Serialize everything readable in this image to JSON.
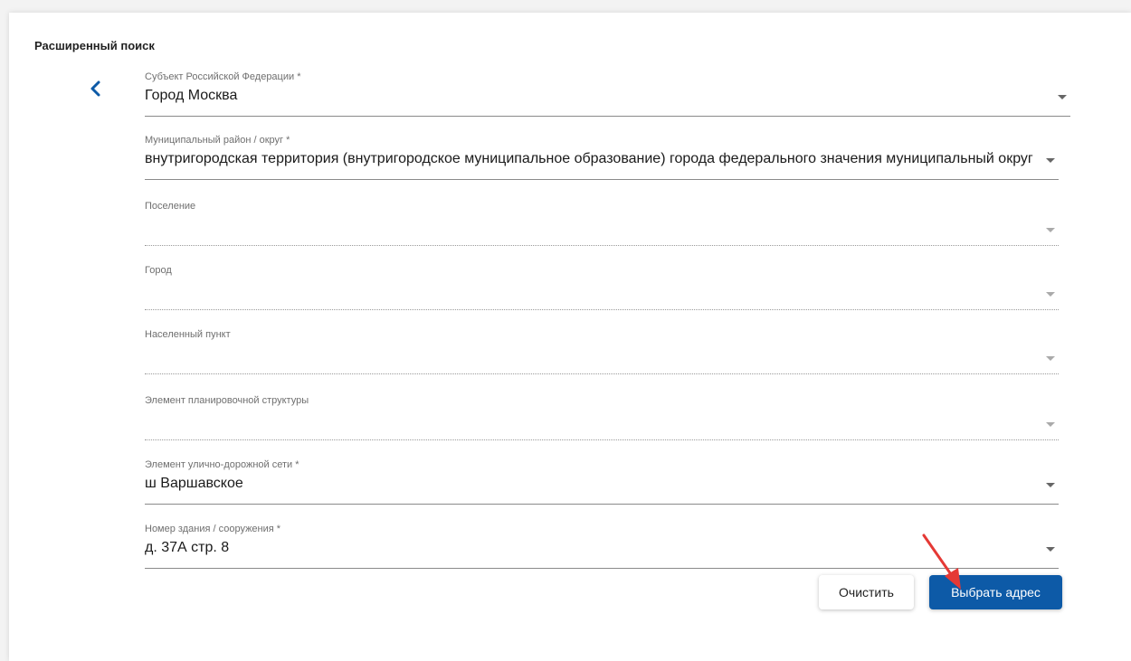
{
  "panel": {
    "title": "Расширенный поиск"
  },
  "fields": [
    {
      "label": "Субъект Российской Федерации *",
      "value": "Город Москва",
      "filled": true
    },
    {
      "label": "Муниципальный район / округ *",
      "value": "внутригородская территория (внутригородское муниципальное образование) города федерального значения муниципальный округ",
      "filled": true
    },
    {
      "label": "Поселение",
      "value": "",
      "filled": false
    },
    {
      "label": "Город",
      "value": "",
      "filled": false
    },
    {
      "label": "Населенный пункт",
      "value": "",
      "filled": false
    },
    {
      "label": "Элемент планировочной структуры",
      "value": "",
      "filled": false
    },
    {
      "label": "Элемент улично-дорожной сети *",
      "value": "ш Варшавское",
      "filled": true
    },
    {
      "label": "Номер здания / сооружения *",
      "value": "д. 37А стр. 8",
      "filled": true
    }
  ],
  "buttons": {
    "clear_label": "Очистить",
    "select_label": "Выбрать адрес"
  },
  "colors": {
    "primary": "#0d5aa7",
    "back_icon": "#0d5aa7",
    "annotation_arrow": "#e53935"
  },
  "icons": {
    "back": "chevron-left-icon",
    "dropdown": "caret-down-icon"
  }
}
